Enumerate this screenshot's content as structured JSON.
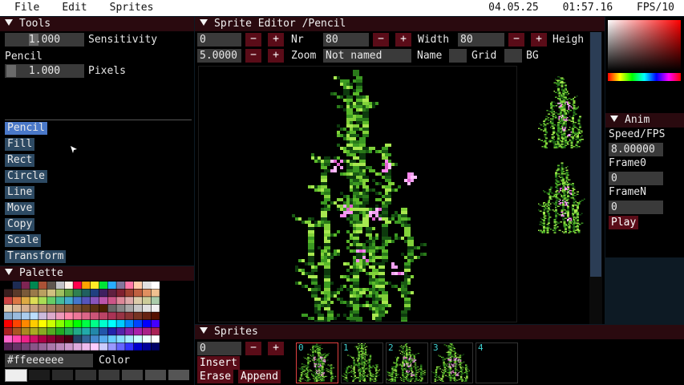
{
  "menu": {
    "file": "File",
    "edit": "Edit",
    "sprites": "Sprites",
    "date": "04.05.25",
    "time": "01:57.16",
    "fps": "FPS/10"
  },
  "tools": {
    "title": "Tools",
    "sensitivity_value": "1.000",
    "sensitivity_label": "Sensitivity",
    "current_tool": "Pencil",
    "pixels_value": "1.000",
    "pixels_label": "Pixels",
    "items": [
      "Pencil",
      "Fill",
      "Rect",
      "Circle",
      "Line",
      "Move",
      "Copy",
      "Scale",
      "Transform"
    ],
    "active": "Pencil"
  },
  "palette": {
    "title": "Palette",
    "hex_value": "#ffeeeeee",
    "color_label": "Color",
    "current_color": "#eeeeee"
  },
  "editor": {
    "title": "Sprite Editor /Pencil",
    "nr_value": "0",
    "nr_label": "Nr",
    "height_value": "80",
    "width_label": "Width",
    "width_value": "80",
    "height_label": "Heigh",
    "zoom_value": "5.0000",
    "zoom_label": "Zoom",
    "name_value": "Not named",
    "name_label": "Name",
    "grid_label": "Grid",
    "bg_label": "BG",
    "minus": "−",
    "plus": "+"
  },
  "anim": {
    "title": "Anim",
    "speed_label": "Speed/FPS",
    "speed_value": "8.00000",
    "frame0_label": "Frame0",
    "frame0_value": "0",
    "framen_label": "FrameN",
    "framen_value": "0",
    "play": "Play"
  },
  "sprites": {
    "title": "Sprites",
    "index_value": "0",
    "insert": "Insert",
    "erase": "Erase",
    "append": "Append",
    "thumbs": [
      "0",
      "1",
      "2",
      "3",
      "4"
    ]
  }
}
